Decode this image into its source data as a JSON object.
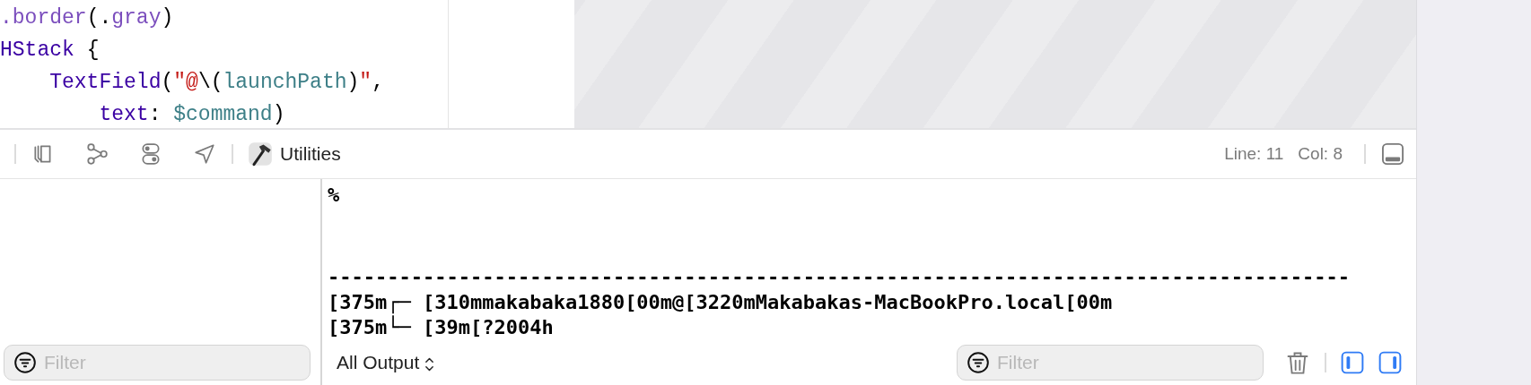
{
  "editor": {
    "code_lines": [
      [
        {
          "kind": "member",
          "text": ".border"
        },
        {
          "kind": "plain",
          "text": "(."
        },
        {
          "kind": "member",
          "text": "gray"
        },
        {
          "kind": "plain",
          "text": ")"
        }
      ],
      [
        {
          "kind": "type",
          "text": "HStack"
        },
        {
          "kind": "plain",
          "text": " {"
        }
      ],
      [
        {
          "kind": "type",
          "text": "    TextField"
        },
        {
          "kind": "plain",
          "text": "("
        },
        {
          "kind": "string",
          "text": "\""
        },
        {
          "kind": "string_accent",
          "text": "@"
        },
        {
          "kind": "plain",
          "text": "\\("
        },
        {
          "kind": "var",
          "text": "launchPath"
        },
        {
          "kind": "plain",
          "text": ")"
        },
        {
          "kind": "string",
          "text": "\""
        },
        {
          "kind": "plain",
          "text": ","
        }
      ],
      [
        {
          "kind": "type",
          "text": "        text"
        },
        {
          "kind": "plain",
          "text": ": "
        },
        {
          "kind": "var",
          "text": "$command"
        },
        {
          "kind": "plain",
          "text": ")"
        }
      ]
    ]
  },
  "toolbar": {
    "scheme_label": "Utilities",
    "line": "Line: 11",
    "col": "Col: 8",
    "debug_toggle_on": false
  },
  "console": {
    "lines": [
      "%",
      "--------------------------------------------------------------------------------------",
      "[375m┌─ [310mmakabaka1880[00m@[3220mMakabakas-MacBookPro.local[00m",
      "[375m└─ [39m[?2004h"
    ]
  },
  "bottom_bar": {
    "left_filter": {
      "placeholder": "Filter"
    },
    "output_menu": "All Output",
    "right_filter": {
      "placeholder": "Filter"
    },
    "panel_toggles": [
      {
        "on": true
      },
      {
        "on": true
      }
    ]
  }
}
